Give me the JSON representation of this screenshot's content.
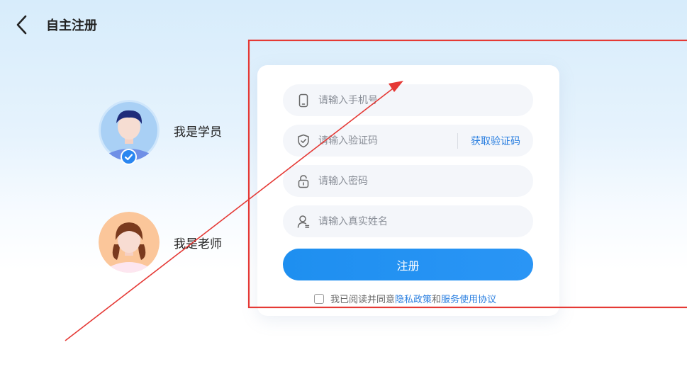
{
  "header": {
    "title": "自主注册"
  },
  "roles": [
    {
      "label": "我是学员",
      "selected": true
    },
    {
      "label": "我是老师",
      "selected": false
    }
  ],
  "form": {
    "phone_placeholder": "请输入手机号",
    "code_placeholder": "请输入验证码",
    "get_code_label": "获取验证码",
    "password_placeholder": "请输入密码",
    "name_placeholder": "请输入真实姓名",
    "submit_label": "注册"
  },
  "agreement": {
    "prefix": "我已阅读并同意",
    "privacy_link": "隐私政策",
    "and": "和",
    "service_link": "服务使用协议"
  },
  "colors": {
    "accent": "#1e8ff0",
    "annotation_red": "#e53935"
  }
}
